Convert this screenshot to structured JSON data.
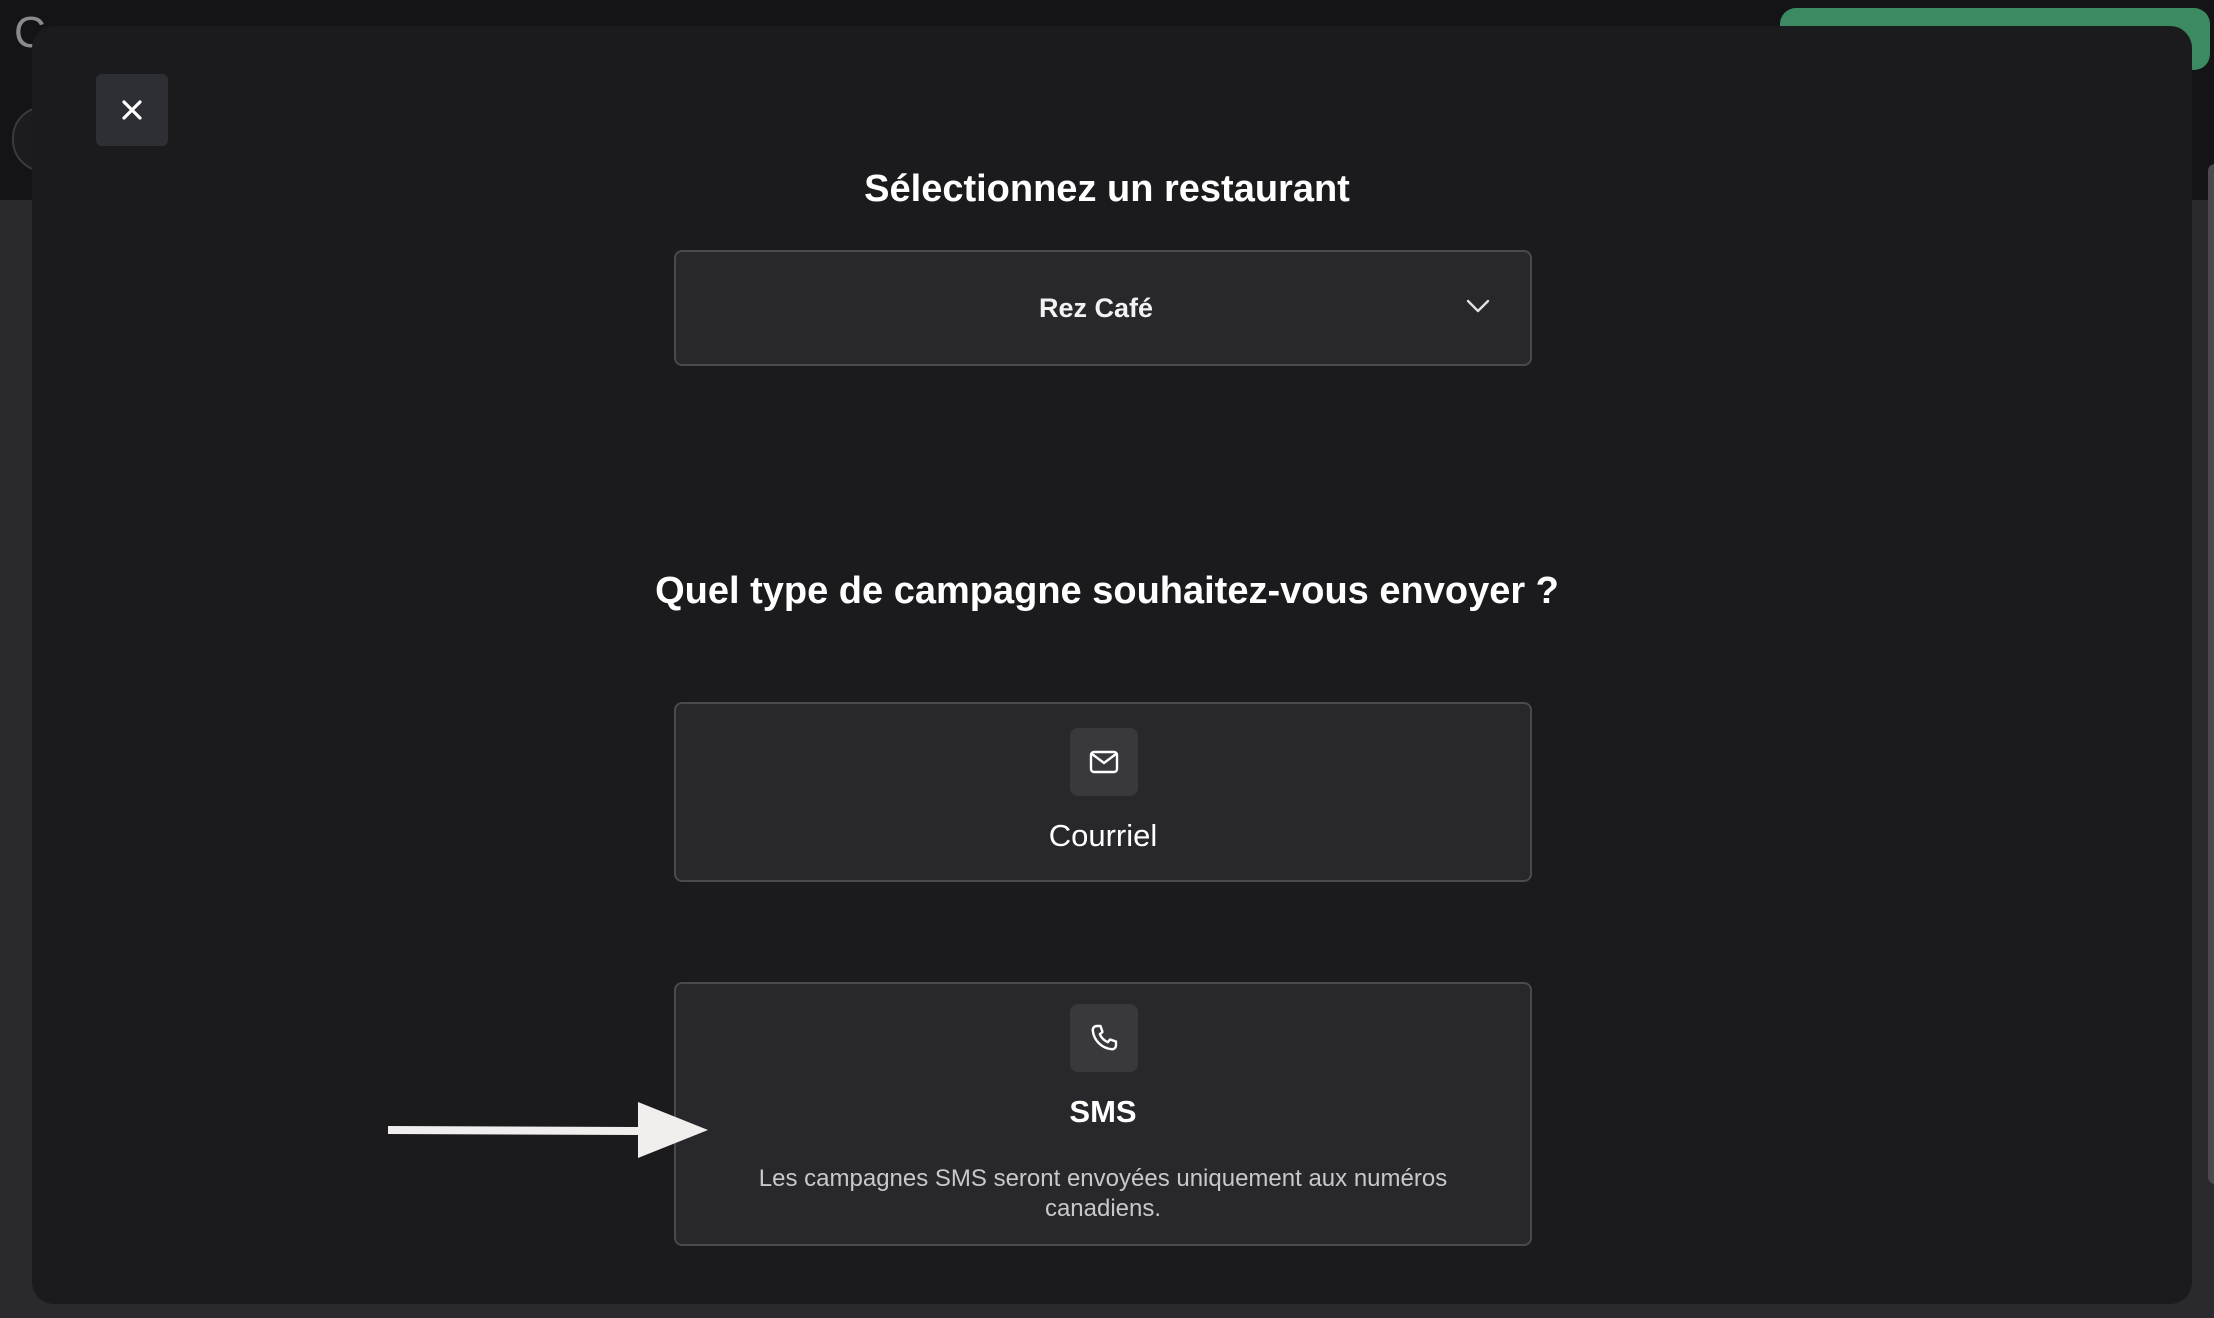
{
  "background": {
    "title_fragment": "C",
    "accent_color": "#3b8a62"
  },
  "modal": {
    "close_icon": "close-icon",
    "restaurant_heading": "Sélectionnez un restaurant",
    "restaurant_select": {
      "value": "Rez Café",
      "icon": "chevron-down-icon"
    },
    "campaign_heading": "Quel type de campagne souhaitez-vous envoyer ?",
    "options": [
      {
        "icon": "mail-icon",
        "label": "Courriel"
      },
      {
        "icon": "phone-icon",
        "label": "SMS",
        "note": "Les campagnes SMS seront envoyées uniquement aux numéros canadiens."
      }
    ]
  },
  "annotation": {
    "icon": "arrow-right-icon",
    "color": "#f2eeee"
  }
}
